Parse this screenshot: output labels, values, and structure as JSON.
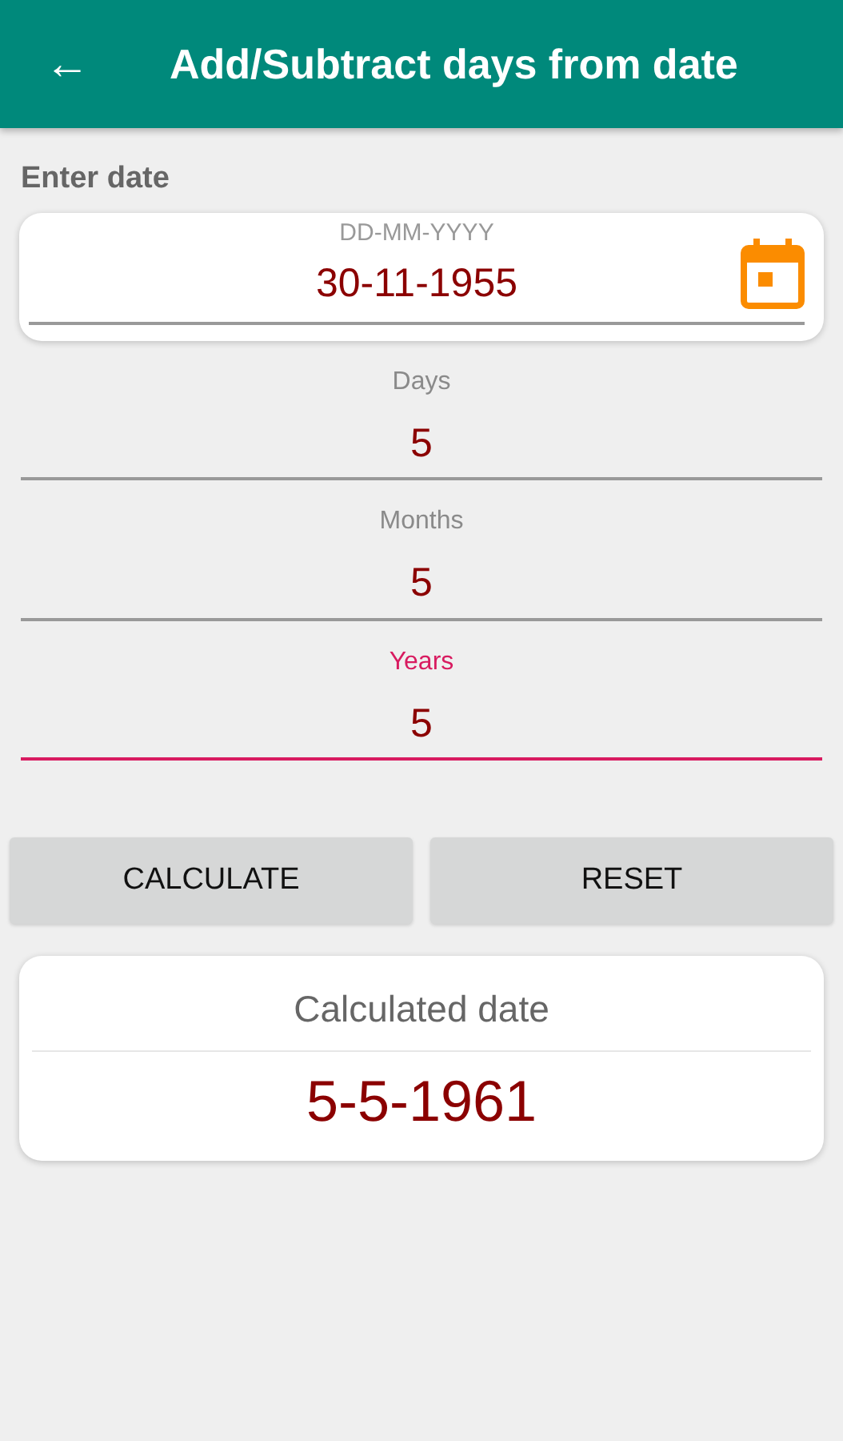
{
  "app_bar": {
    "back_icon": "←",
    "title": "Add/Subtract days from date"
  },
  "date_section": {
    "heading": "Enter date",
    "field": {
      "label": "DD-MM-YYYY",
      "value": "30-11-1955"
    }
  },
  "fields": [
    {
      "label": "Days",
      "value": "5",
      "focused": false
    },
    {
      "label": "Months",
      "value": "5",
      "focused": false
    },
    {
      "label": "Years",
      "value": "5",
      "focused": true
    }
  ],
  "buttons": [
    "CALCULATE",
    "RESET"
  ],
  "result": {
    "title": "Calculated date",
    "value": "5-5-1961"
  }
}
